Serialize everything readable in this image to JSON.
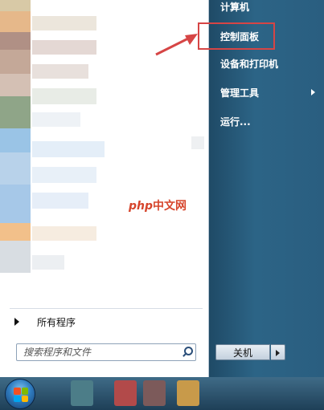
{
  "start_menu": {
    "right_items": [
      {
        "label": "计算机",
        "has_submenu": false
      },
      {
        "label": "控制面板",
        "has_submenu": false,
        "highlighted": true
      },
      {
        "label": "设备和打印机",
        "has_submenu": false
      },
      {
        "label": "管理工具",
        "has_submenu": true
      },
      {
        "label": "运行...",
        "has_submenu": false
      }
    ],
    "all_programs_label": "所有程序",
    "search_placeholder": "搜索程序和文件",
    "shutdown_label": "关机"
  },
  "watermark": {
    "php": "php",
    "text": "中文网"
  },
  "colors": {
    "highlight_border": "#d64545",
    "annotation_arrow": "#d64545",
    "right_panel": "#2c6486",
    "taskbar": "#2a4d62"
  }
}
